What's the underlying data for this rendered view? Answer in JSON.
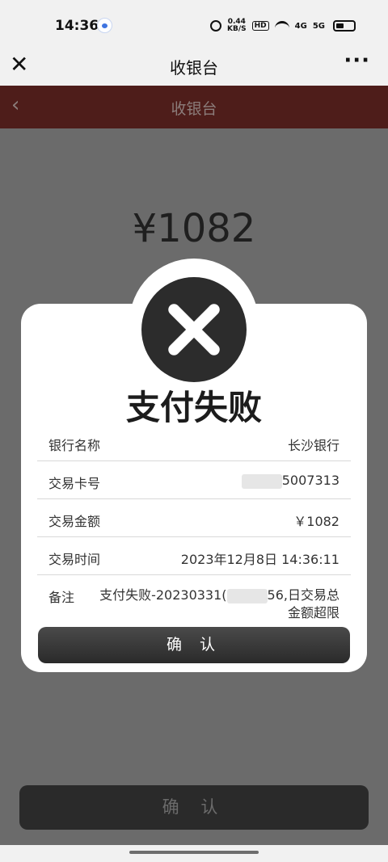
{
  "status": {
    "time": "14:36",
    "speed_value": "0.44",
    "speed_unit": "KB/S",
    "hd": "HD",
    "sig1": "4G",
    "sig2": "5G"
  },
  "nav": {
    "close": "✕",
    "title": "收银台",
    "more": "···"
  },
  "header": {
    "back": "‹",
    "title": "收银台"
  },
  "amount": "¥1082",
  "dialog": {
    "title": "支付失败",
    "rows": [
      {
        "label": "银行名称",
        "value": "长沙银行"
      },
      {
        "label": "交易卡号",
        "value": "5007313"
      },
      {
        "label": "交易金额",
        "value": "￥1082"
      },
      {
        "label": "交易时间",
        "value": "2023年12月8日 14:36:11"
      }
    ],
    "note": {
      "label": "备注",
      "value_prefix": "支付失败-20230331(",
      "value_suffix": "56,日交易总金额超限"
    },
    "confirm_label": "确 认"
  },
  "bottom_button_label": "确 认",
  "colors": {
    "header": "#4e1d1a",
    "overlay": "#6b6b6b",
    "button": "#2a2a2a"
  }
}
